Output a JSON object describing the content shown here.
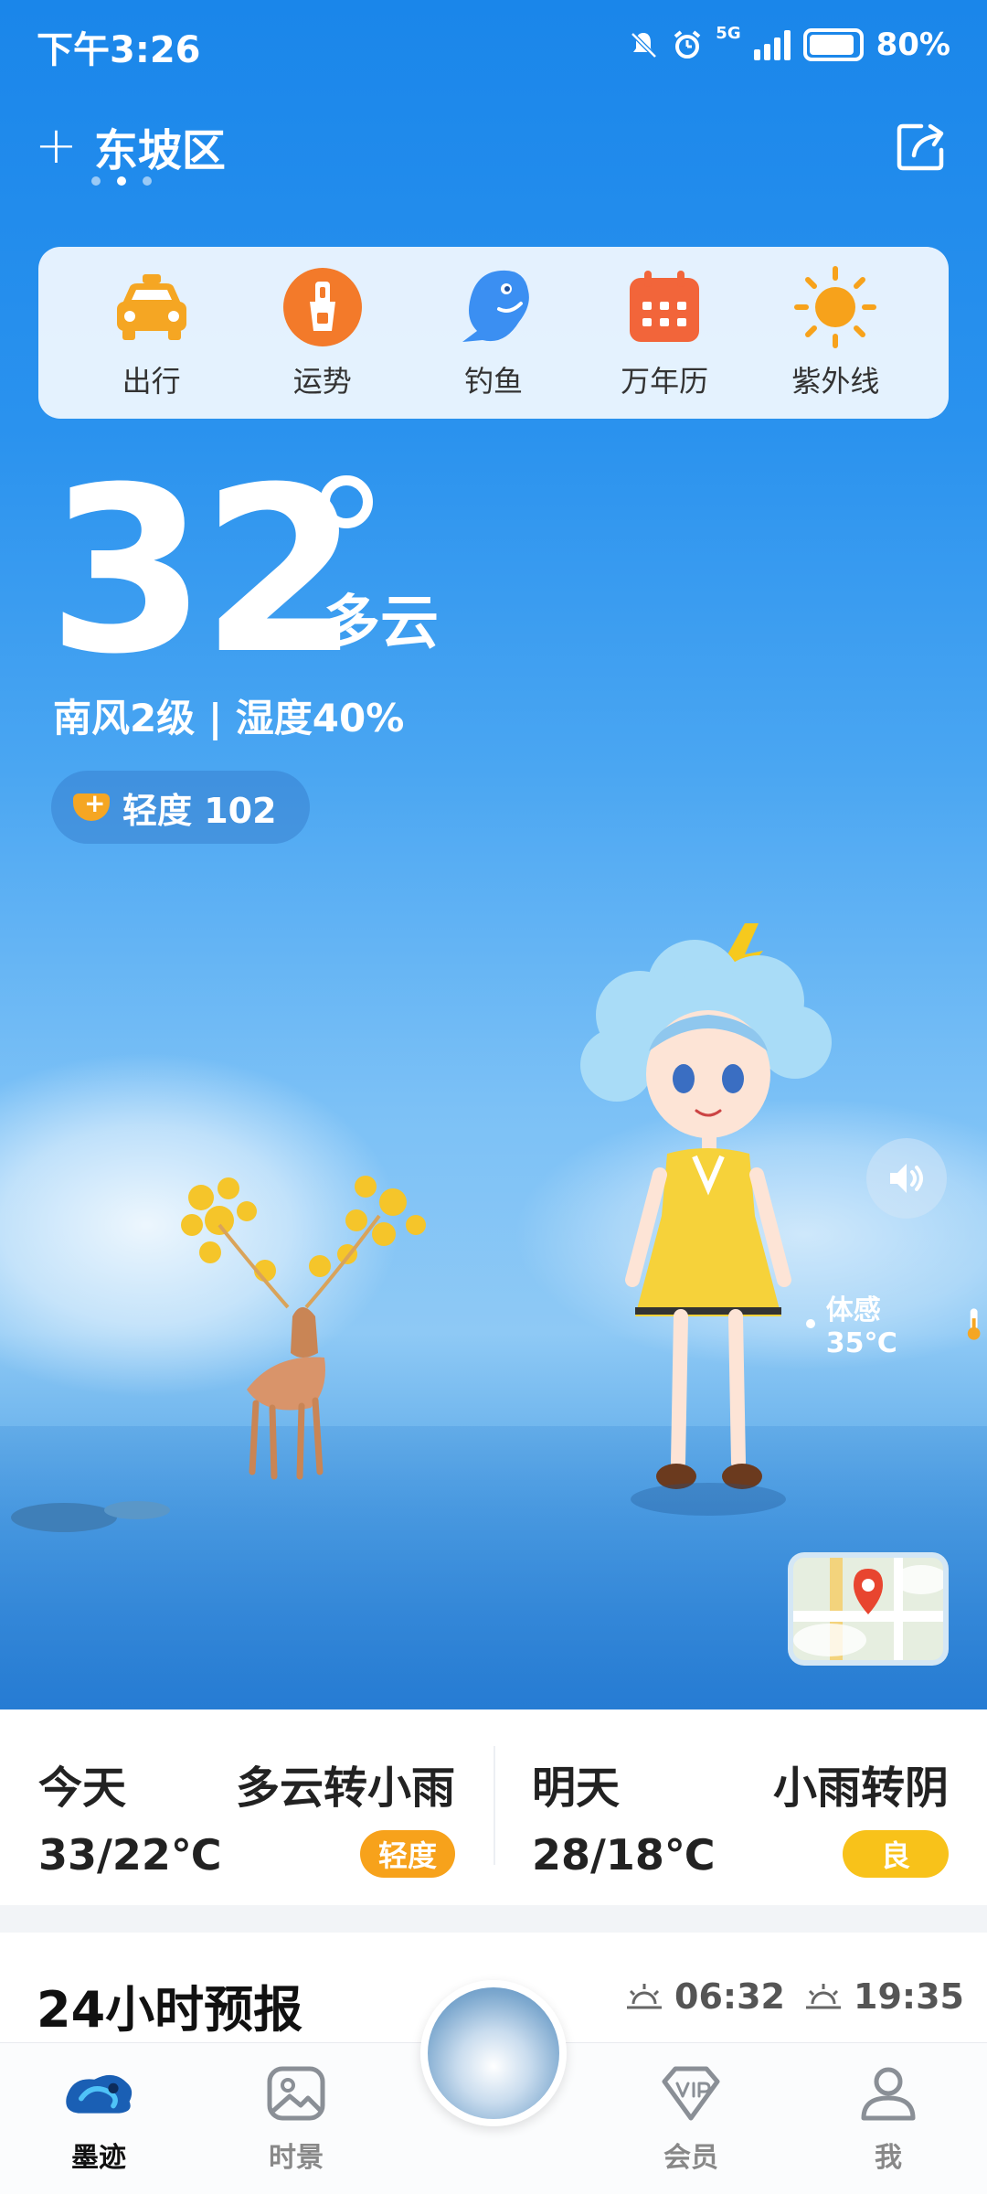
{
  "status": {
    "time": "下午3:26",
    "network": "5G",
    "battery": "80%"
  },
  "location": {
    "name": "东坡区",
    "page_dots": 3,
    "active_dot": 2
  },
  "quick_actions": [
    {
      "label": "出行",
      "icon": "taxi-icon"
    },
    {
      "label": "运势",
      "icon": "fortune-icon"
    },
    {
      "label": "钓鱼",
      "icon": "fish-icon"
    },
    {
      "label": "万年历",
      "icon": "calendar-icon"
    },
    {
      "label": "紫外线",
      "icon": "sun-icon"
    }
  ],
  "current": {
    "temperature": "32",
    "condition": "多云",
    "wind_humidity": "南风2级 | 湿度40%",
    "aqi": "轻度 102",
    "feels_like": "体感35℃"
  },
  "forecast": {
    "today": {
      "day": "今天",
      "desc": "多云转小雨",
      "temp": "33/22℃",
      "aqi": "轻度"
    },
    "tomorrow": {
      "day": "明天",
      "desc": "小雨转阴",
      "temp": "28/18℃",
      "aqi": "良"
    }
  },
  "hourly": {
    "title": "24小时预报",
    "sunrise": "06:32",
    "sunset": "19:35"
  },
  "tabs": [
    {
      "label": "墨迹",
      "icon": "moji-logo-icon",
      "active": true
    },
    {
      "label": "时景",
      "icon": "photo-icon",
      "active": false
    },
    {
      "label": "会员",
      "icon": "vip-icon",
      "active": false
    },
    {
      "label": "我",
      "icon": "user-icon",
      "active": false
    }
  ],
  "colors": {
    "accent": "#1a86ea",
    "aqi_light": "#f7a21b",
    "aqi_good": "#f8c21a"
  }
}
